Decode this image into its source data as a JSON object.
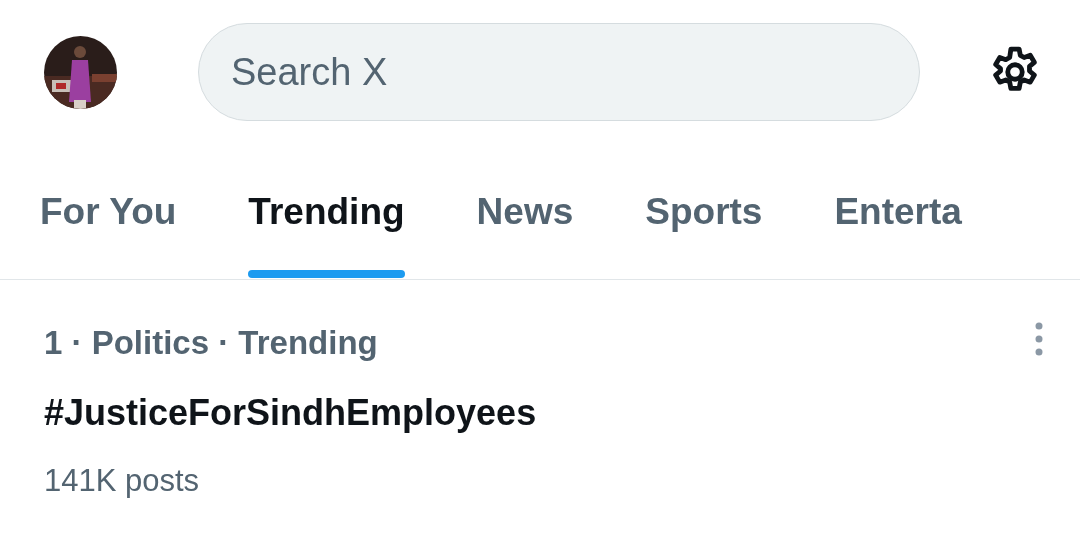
{
  "header": {
    "search": {
      "placeholder": "Search X"
    }
  },
  "tabs": [
    {
      "label": "For You",
      "selected": false
    },
    {
      "label": "Trending",
      "selected": true
    },
    {
      "label": "News",
      "selected": false
    },
    {
      "label": "Sports",
      "selected": false
    },
    {
      "label": "Enterta",
      "selected": false
    }
  ],
  "trends": [
    {
      "context": "1 · Politics · Trending",
      "title": "#JusticeForSindhEmployees",
      "count": "141K posts"
    }
  ]
}
